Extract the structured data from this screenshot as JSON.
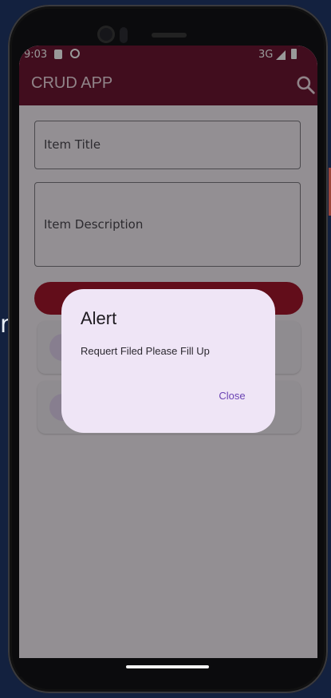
{
  "status_bar": {
    "time": "9:03",
    "network": "3G"
  },
  "app_bar": {
    "title": "CRUD APP",
    "search_icon": "search-icon"
  },
  "form": {
    "title_placeholder": "Item Title",
    "description_placeholder": "Item Description"
  },
  "dialog": {
    "title": "Alert",
    "message": "Requert Filed Please Fill Up",
    "close_label": "Close"
  },
  "background": {
    "side_letter": "r"
  },
  "colors": {
    "app_bar": "#6d1632",
    "button": "#a3172c",
    "dialog_bg": "#efe5f6",
    "dialog_action": "#6a43b3",
    "page_bg": "#13213f"
  }
}
